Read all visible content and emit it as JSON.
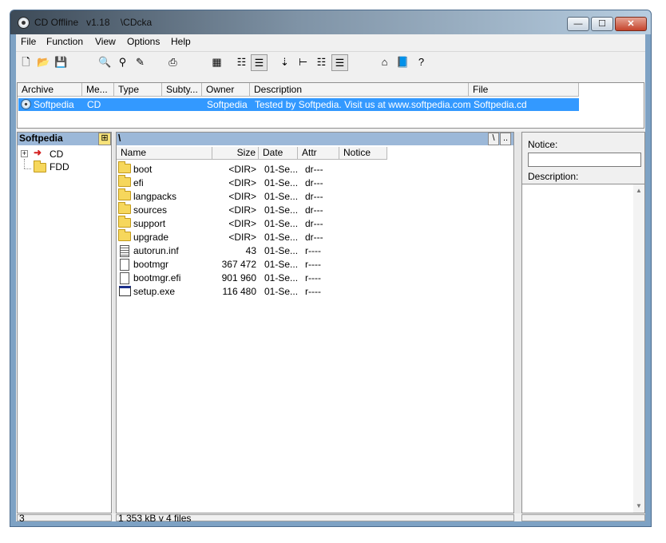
{
  "window": {
    "title": "CD Offline   v1.18    \\CDcka",
    "controls": {
      "minimize": "—",
      "maximize": "☐",
      "close": "✕"
    }
  },
  "menu": [
    "File",
    "Function",
    "View",
    "Options",
    "Help"
  ],
  "toolbar": {
    "icons": [
      "new-icon",
      "open-icon",
      "save-icon",
      "search-icon",
      "find-icon",
      "edit-icon",
      "print-icon",
      "grid-icon",
      "list-icon",
      "details-icon",
      "sort-name-icon",
      "tree-icon",
      "tree-list-icon",
      "detail-list-icon",
      "home-icon",
      "book-icon",
      "help-icon"
    ]
  },
  "archives": {
    "columns": [
      "Archive",
      "Me...",
      "Type",
      "Subty...",
      "Owner",
      "Description",
      "File"
    ],
    "rows": [
      {
        "archive": "Softpedia",
        "media": "CD",
        "type": "",
        "subtype": "",
        "owner": "Softpedia",
        "description": "Tested by Softpedia. Visit us at www.softpedia.com",
        "file": "Softpedia.cd"
      }
    ]
  },
  "tree": {
    "header": "Softpedia",
    "items": [
      {
        "label": "CD"
      },
      {
        "label": "FDD"
      }
    ]
  },
  "files": {
    "path": "\\",
    "path_buttons": [
      "\\",
      ".."
    ],
    "columns": [
      "Name",
      "Size",
      "Date",
      "Attr",
      "Notice"
    ],
    "rows": [
      {
        "icon": "folder-icon",
        "name": "boot",
        "size": "<DIR>",
        "date": "01-Se...",
        "attr": "dr---"
      },
      {
        "icon": "folder-icon",
        "name": "efi",
        "size": "<DIR>",
        "date": "01-Se...",
        "attr": "dr---"
      },
      {
        "icon": "folder-icon",
        "name": "langpacks",
        "size": "<DIR>",
        "date": "01-Se...",
        "attr": "dr---"
      },
      {
        "icon": "folder-icon",
        "name": "sources",
        "size": "<DIR>",
        "date": "01-Se...",
        "attr": "dr---"
      },
      {
        "icon": "folder-icon",
        "name": "support",
        "size": "<DIR>",
        "date": "01-Se...",
        "attr": "dr---"
      },
      {
        "icon": "folder-icon",
        "name": "upgrade",
        "size": "<DIR>",
        "date": "01-Se...",
        "attr": "dr---"
      },
      {
        "icon": "text-file-icon",
        "name": "autorun.inf",
        "size": "43",
        "date": "01-Se...",
        "attr": "r----"
      },
      {
        "icon": "file-icon",
        "name": "bootmgr",
        "size": "367 472",
        "date": "01-Se...",
        "attr": "r----"
      },
      {
        "icon": "file-icon",
        "name": "bootmgr.efi",
        "size": "901 960",
        "date": "01-Se...",
        "attr": "r----"
      },
      {
        "icon": "exe-icon",
        "name": "setup.exe",
        "size": "116 480",
        "date": "01-Se...",
        "attr": "r----"
      }
    ]
  },
  "notice": {
    "notice_label": "Notice:",
    "notice_value": "",
    "description_label": "Description:"
  },
  "status": {
    "left": "3",
    "middle": "1 353 kB v 4 files",
    "right": ""
  },
  "colors": {
    "selection": "#3399ff",
    "pane_header": "#9cb8d8"
  }
}
